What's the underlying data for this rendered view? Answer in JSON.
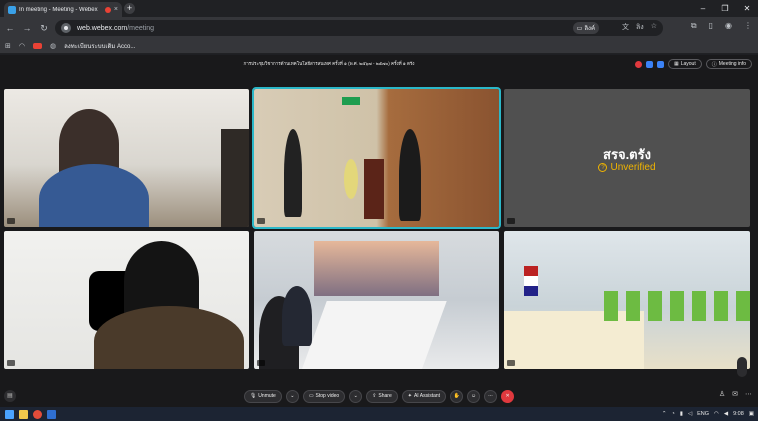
{
  "browser": {
    "tab_title": "In meeting - Meeting - Webex",
    "tab_close": "×",
    "new_tab": "+",
    "window_controls": [
      "–",
      "❐",
      "✕"
    ],
    "url_domain": "web.webex.com",
    "url_path": "/meeting",
    "translate_label": "ลิงค์",
    "profile_label": "ลิง",
    "bookmark_label": "ลงทะเบียนระบบเดิม Acco..."
  },
  "meeting": {
    "title": "การประชุมวิชาการด้านเทคโนโลยีสารสนเทศ ครั้งที่ ๑ (พ.ศ. ๒๕๖๗ - ๒๕๗๐) ครั้งที่ ๑ ตรัง",
    "layout_label": "Layout",
    "info_label": "Meeting info",
    "participant_name": "สรจ.ตรัง",
    "unverified_label": "Unverified",
    "unverified_icon": "?"
  },
  "controls": {
    "unmute": "Unmute",
    "stop_video": "Stop video",
    "share": "Share",
    "ai_assistant": "AI Assistant",
    "leave_icon": "✕"
  },
  "taskbar": {
    "lang": "ENG",
    "time": "9:08"
  },
  "colors": {
    "active_speaker_border": "#2bb7c8",
    "leave": "#e0393e",
    "unverified": "#f0b400"
  }
}
